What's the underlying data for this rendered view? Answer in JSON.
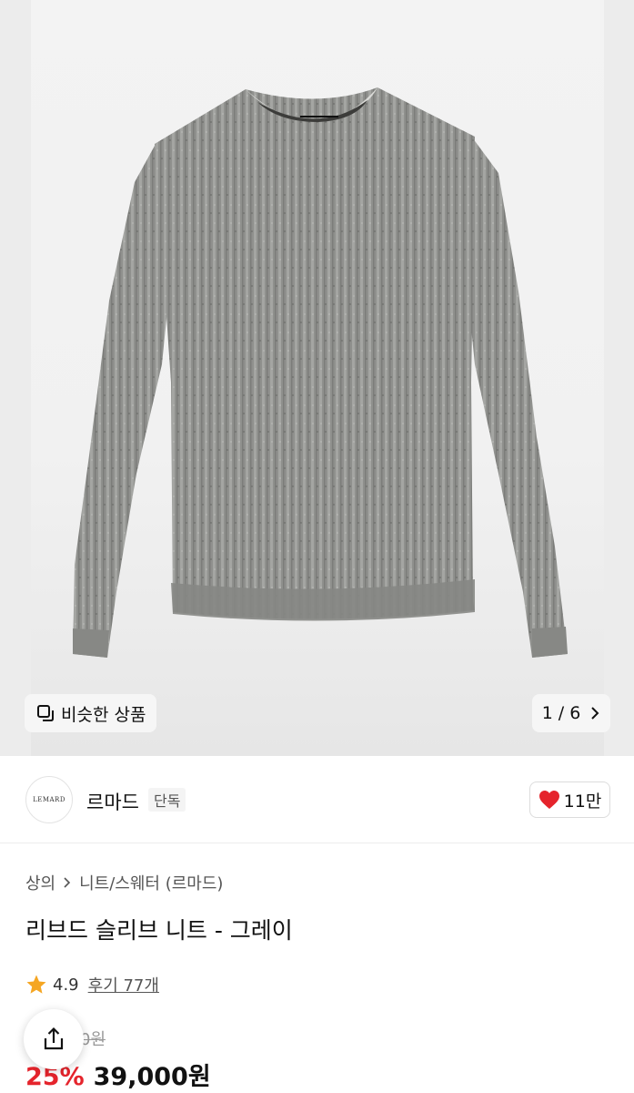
{
  "gallery": {
    "similar_label": "비슷한 상품",
    "current_page": "1",
    "page_separator": "/",
    "total_pages": "6"
  },
  "brand": {
    "logo_text": "LEMARD",
    "name": "르마드",
    "badge": "단독",
    "likes": "11만"
  },
  "product": {
    "breadcrumb": [
      "상의",
      "니트/스웨터 (르마드)"
    ],
    "title": "리브드 슬리브 니트 - 그레이",
    "rating": "4.9",
    "review_label": "후기 77개",
    "original_price": "0원",
    "discount": "25%",
    "sale_price": "39,000원"
  },
  "colors": {
    "accent_red": "#e5242c",
    "star": "#f5a623",
    "sweater_gray": "#8e8f8c"
  },
  "icons": {
    "similar": "similar-items-icon",
    "chevron": "chevron-right-icon",
    "heart": "heart-icon",
    "star": "star-icon",
    "share": "share-icon"
  }
}
